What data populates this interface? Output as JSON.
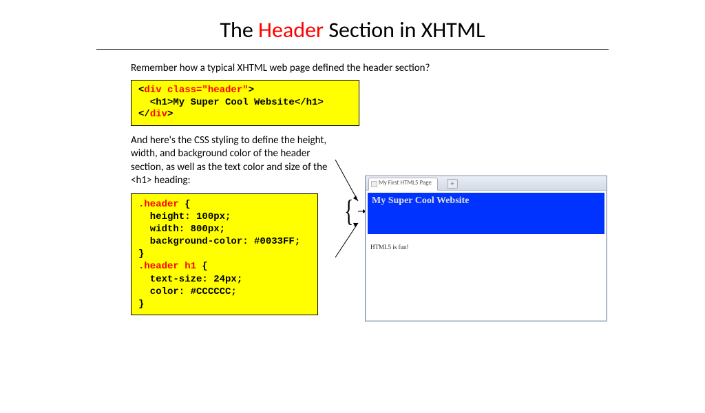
{
  "title_part1": "The ",
  "title_highlight": "Header",
  "title_part2": " Section in XHTML",
  "intro": "Remember how a typical XHTML web page defined the header section?",
  "code1": {
    "l1a": "<",
    "l1b": "div class=\"header\"",
    "l1c": ">",
    "l2": "  <h1>My Super Cool Website</h1>",
    "l3a": "</",
    "l3b": "div",
    "l3c": ">"
  },
  "midtext": "And here's the CSS styling to define the height, width, and background color of the header section, as well as the text color and size of the <h1> heading:",
  "code2": {
    "s1": ".header",
    "s1b": " {",
    "l2": "  height: 100px;",
    "l3": "  width: 800px;",
    "l4": "  background-color: #0033FF;",
    "l5": "}",
    "s2": ".header h1",
    "s2b": " {",
    "l7": "  text-size: 24px;",
    "l8": "  color: #CCCCCC;",
    "l9": "}"
  },
  "curly": "{",
  "mock": {
    "tab_title": "My First HTML5 Page",
    "plus": "+",
    "header_title": "My Super Cool Website",
    "body_text": "HTML5 is fun!"
  }
}
